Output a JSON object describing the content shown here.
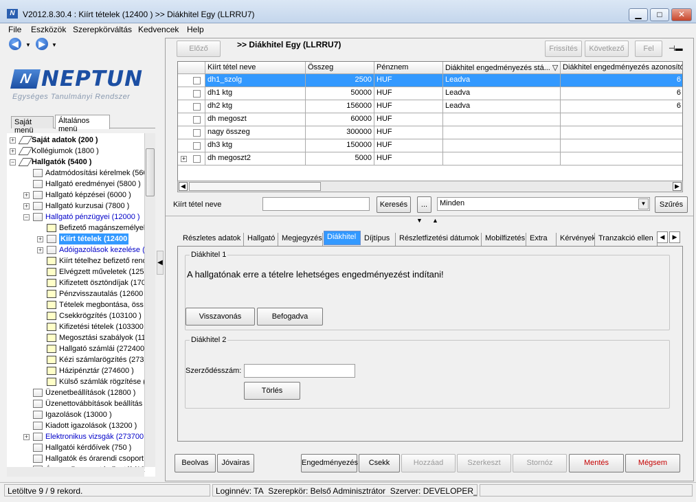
{
  "window": {
    "title": "V2012.8.30.4 : Kiírt tételek (12400 )  >> Diákhitel Egy (LLRRU7)",
    "icon_label": "N",
    "minimize": "▁",
    "maximize": "□",
    "close": "✕"
  },
  "menubar": [
    "File",
    "Eszközök",
    "Szerepkörváltás",
    "Kedvencek",
    "Help"
  ],
  "nav": {
    "back": "◀",
    "forward": "▶",
    "dropdown": "▼"
  },
  "logo": {
    "mark": "N",
    "text": "NEPTUN",
    "subtitle": "Egységes Tanulmányi Rendszer"
  },
  "menu_tabs": [
    "Saját menü",
    "Általános menü"
  ],
  "tree": [
    {
      "label": "Saját adatok (200 )",
      "level": 0,
      "exp": "+",
      "icon": "book",
      "bold": true
    },
    {
      "label": "Kollégiumok (1800 )",
      "level": 0,
      "exp": "+",
      "icon": "book"
    },
    {
      "label": "Hallgatók (5400 )",
      "level": 0,
      "exp": "−",
      "icon": "book",
      "bold": true
    },
    {
      "label": "Adatmódosítási kérelmek (5600",
      "level": 1,
      "icon": "page"
    },
    {
      "label": "Hallgató eredményei (5800 )",
      "level": 1,
      "icon": "page"
    },
    {
      "label": "Hallgató képzései (6000 )",
      "level": 1,
      "exp": "+",
      "icon": "page"
    },
    {
      "label": "Hallgató kurzusai (7800 )",
      "level": 1,
      "exp": "+",
      "icon": "page"
    },
    {
      "label": "Hallgató pénzügyei (12000 )",
      "level": 1,
      "exp": "−",
      "icon": "page",
      "color": "#0000c8"
    },
    {
      "label": "Befizető magánszemélyek",
      "level": 2,
      "icon": "doc"
    },
    {
      "label": "Kiírt tételek (12400",
      "level": 2,
      "exp": "+",
      "icon": "page",
      "selected": true
    },
    {
      "label": "Adóigazolások kezelése (",
      "level": 2,
      "exp": "+",
      "icon": "page",
      "color": "#0000c8"
    },
    {
      "label": "Kiírt tételhez befizető rend",
      "level": 2,
      "icon": "doc"
    },
    {
      "label": "Elvégzett műveletek (125",
      "level": 2,
      "icon": "doc"
    },
    {
      "label": "Kifizetett ösztöndíjak (170",
      "level": 2,
      "icon": "doc"
    },
    {
      "label": "Pénzvisszautalás (12600",
      "level": 2,
      "icon": "doc"
    },
    {
      "label": "Tételek megbontása, öss",
      "level": 2,
      "icon": "doc"
    },
    {
      "label": "Csekkrögzítés (103100 )",
      "level": 2,
      "icon": "doc"
    },
    {
      "label": "Kifizetési tételek (103300",
      "level": 2,
      "icon": "doc"
    },
    {
      "label": "Megosztási szabályok (11",
      "level": 2,
      "icon": "doc"
    },
    {
      "label": "Hallgató számlái (272400",
      "level": 2,
      "icon": "doc"
    },
    {
      "label": "Kézi számlarögzítés (273",
      "level": 2,
      "icon": "doc"
    },
    {
      "label": "Házipénztár (274600 )",
      "level": 2,
      "icon": "doc"
    },
    {
      "label": "Külső számlák rögzítése (",
      "level": 2,
      "icon": "doc"
    },
    {
      "label": "Üzenetbeállítások (12800 )",
      "level": 1,
      "icon": "page"
    },
    {
      "label": "Üzenettovábbítások beállítás",
      "level": 1,
      "icon": "page"
    },
    {
      "label": "Igazolások (13000 )",
      "level": 1,
      "icon": "page"
    },
    {
      "label": "Kiadott igazolások (13200 )",
      "level": 1,
      "icon": "page"
    },
    {
      "label": "Elektronikus vizsgák (273700",
      "level": 1,
      "exp": "+",
      "icon": "page",
      "color": "#0000c8"
    },
    {
      "label": "Hallgatói kérdőívek (750 )",
      "level": 1,
      "icon": "page"
    },
    {
      "label": "Hallgatók és órarendi csoport",
      "level": 1,
      "icon": "page"
    },
    {
      "label": "Órarendi csoport hallgatói (12",
      "level": 1,
      "icon": "page"
    }
  ],
  "toolbar": {
    "prev": "Előző",
    "record_title": ">> Diákhitel Egy (LLRRU7)",
    "refresh": "Frissítés",
    "next": "Következő",
    "up": "Fel",
    "pin": "⊣▬"
  },
  "grid": {
    "columns": [
      "Kiírt tétel neve",
      "Összeg",
      "Pénznem",
      "Diákhitel engedményezés stá... ▽",
      "Diákhitel engedményezés azonosítója"
    ],
    "rows": [
      {
        "name": "dh1_szolg",
        "amount": "2500",
        "currency": "HUF",
        "status": "Leadva",
        "id": "6",
        "selected": true
      },
      {
        "name": "dh1 ktg",
        "amount": "50000",
        "currency": "HUF",
        "status": "Leadva",
        "id": "6"
      },
      {
        "name": "dh2 ktg",
        "amount": "156000",
        "currency": "HUF",
        "status": "Leadva",
        "id": "6"
      },
      {
        "name": "dh megoszt",
        "amount": "60000",
        "currency": "HUF",
        "status": "",
        "id": ""
      },
      {
        "name": "nagy összeg",
        "amount": "300000",
        "currency": "HUF",
        "status": "",
        "id": ""
      },
      {
        "name": "dh3 ktg",
        "amount": "150000",
        "currency": "HUF",
        "status": "",
        "id": ""
      },
      {
        "name": "dh megoszt2",
        "amount": "5000",
        "currency": "HUF",
        "status": "",
        "id": "",
        "expandable": true
      }
    ]
  },
  "filter": {
    "label": "Kiírt tétel neve",
    "value": "",
    "search": "Keresés",
    "more": "...",
    "select_value": "Minden",
    "filter_button": "Szűrés"
  },
  "tabs": [
    "Részletes adatok",
    "Hallgató",
    "Megjegyzés",
    "Diákhitel",
    "Díjtípus",
    "Részletfizetési dátumok",
    "Mobilfizetés",
    "Extra",
    "Kérvények",
    "Tranzakció ellen"
  ],
  "active_tab": "Diákhitel",
  "dh1": {
    "title": "Diákhitel 1",
    "message": "A hallgatónak erre a tételre lehetséges engedményezést indítani!",
    "revoke": "Visszavonás",
    "accepted": "Befogadva"
  },
  "dh2": {
    "title": "Diákhitel 2",
    "contract_label": "Szerződésszám:",
    "contract_value": "",
    "delete": "Törlés"
  },
  "bottom": {
    "beolvas": "Beolvas",
    "jovairas": "Jóvairas",
    "engedmenyezes": "Engedményezés",
    "csekk": "Csekk",
    "hozzaad": "Hozzáad",
    "szerkeszt": "Szerkeszt",
    "storno": "Stornóz",
    "mentes": "Mentés",
    "megsem": "Mégsem"
  },
  "status": {
    "records": "Letöltve 9 / 9 rekord.",
    "login": "Loginnév: TA",
    "role": "Szerepkör: Belső Adminisztrátor",
    "server": "Szerver: DEVELOPER_Te"
  }
}
